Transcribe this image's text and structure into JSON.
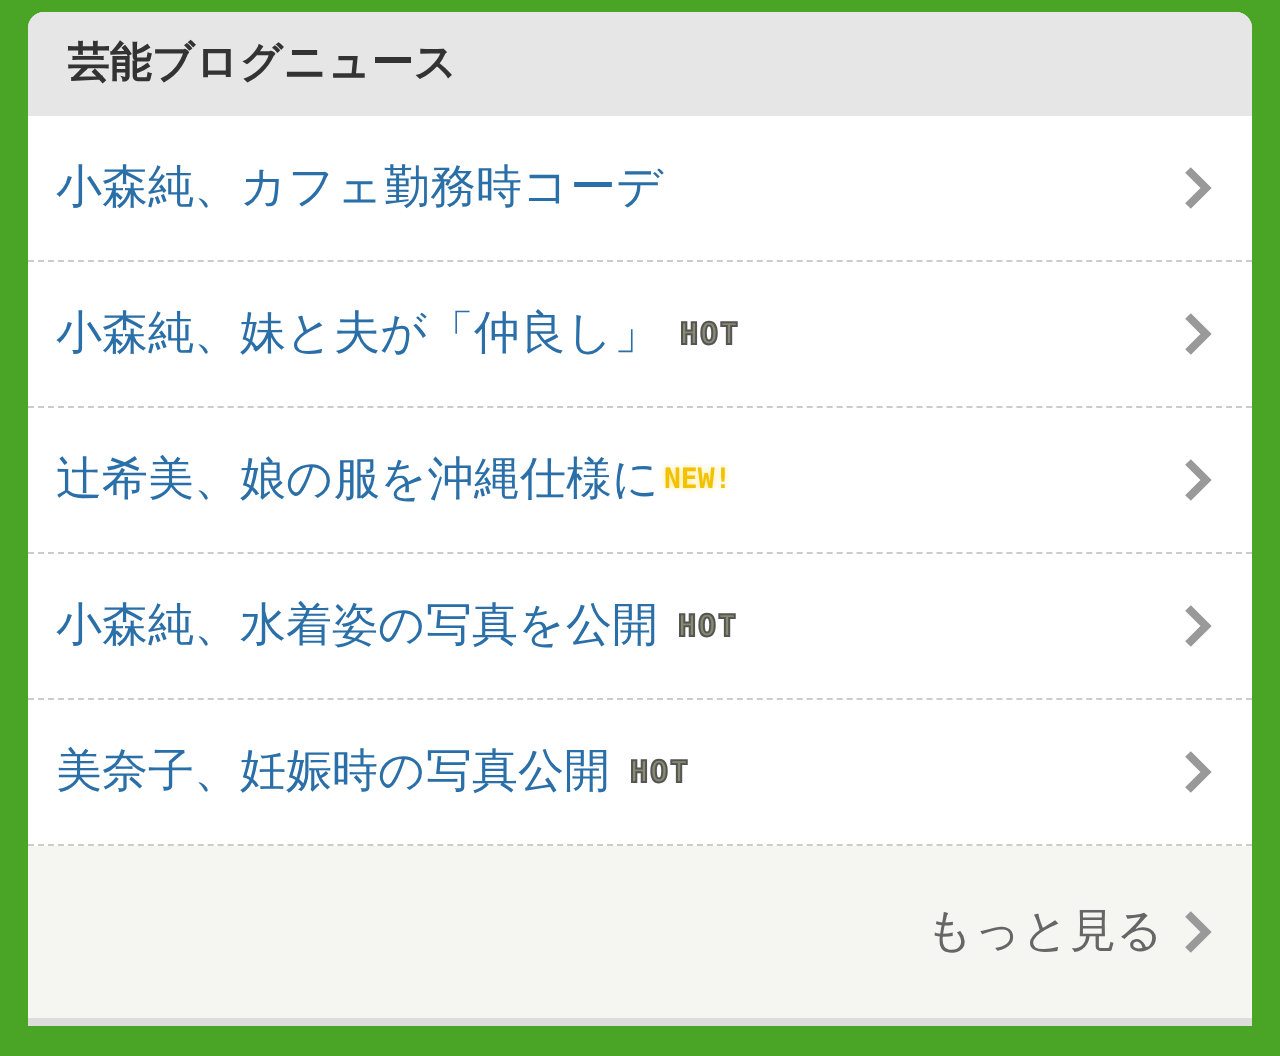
{
  "header": {
    "title": "芸能ブログニュース"
  },
  "items": [
    {
      "title": "小森純、カフェ勤務時コーデ"
    },
    {
      "title": "小森純、妹と夫が「仲良し」",
      "badge": {
        "kind": "hot",
        "text": "HOT"
      }
    },
    {
      "title": "辻希美、娘の服を沖縄仕様に",
      "badge": {
        "kind": "new",
        "text": "NEW!"
      }
    },
    {
      "title": "小森純、水着姿の写真を公開",
      "badge": {
        "kind": "hot",
        "text": "HOT"
      }
    },
    {
      "title": "美奈子、妊娠時の写真公開",
      "badge": {
        "kind": "hot",
        "text": "HOT"
      }
    }
  ],
  "more": {
    "label": "もっと見る"
  }
}
